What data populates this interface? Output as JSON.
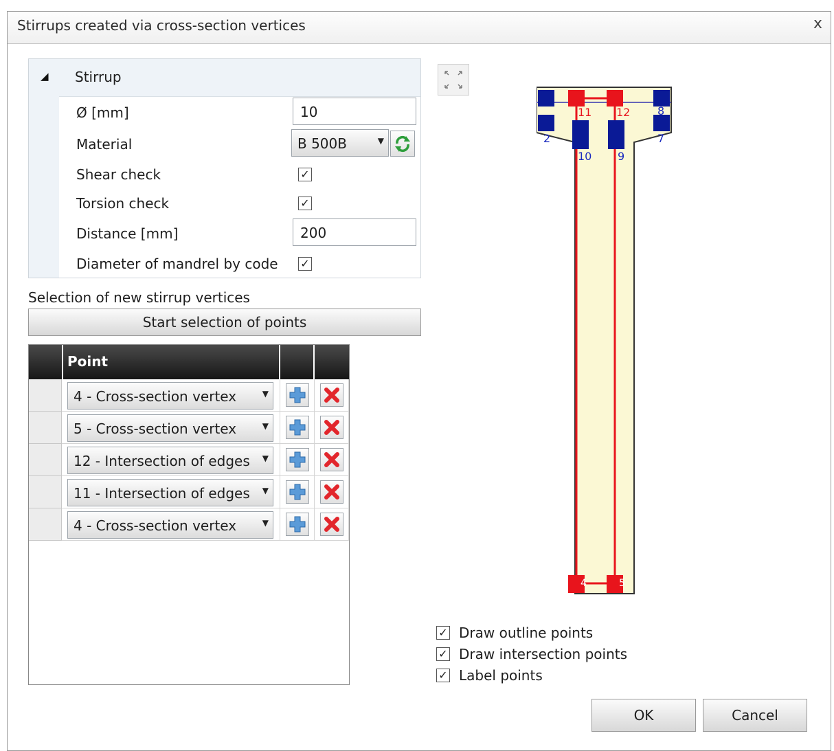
{
  "dialog": {
    "title": "Stirrups created via cross-section vertices",
    "close_label": "x"
  },
  "stirrup": {
    "header": "Stirrup",
    "diameter_label": "Ø [mm]",
    "diameter_value": "10",
    "material_label": "Material",
    "material_value": "B 500B",
    "shear_label": "Shear check",
    "shear_checked": true,
    "torsion_label": "Torsion check",
    "torsion_checked": true,
    "distance_label": "Distance [mm]",
    "distance_value": "200",
    "mandrel_label": "Diameter of mandrel by code",
    "mandrel_checked": true
  },
  "selection": {
    "label": "Selection of new stirrup vertices",
    "button_label": "Start selection of points"
  },
  "grid": {
    "header_point": "Point",
    "rows": [
      {
        "point": "4 - Cross-section vertex"
      },
      {
        "point": "5 - Cross-section vertex"
      },
      {
        "point": "12 - Intersection of edges"
      },
      {
        "point": "11 - Intersection of edges"
      },
      {
        "point": "4 - Cross-section vertex"
      }
    ]
  },
  "section_labels": [
    "2",
    "11",
    "12",
    "8",
    "10",
    "9",
    "7",
    "4",
    "5"
  ],
  "options": {
    "draw_outline_points": "Draw outline points",
    "draw_intersection_points": "Draw intersection points",
    "label_points": "Label points"
  },
  "buttons": {
    "ok": "OK",
    "cancel": "Cancel"
  },
  "colors": {
    "stirrup_red": "#e8141c",
    "vertex_blue": "#0a1a96",
    "section_fill": "#fbf8d4"
  }
}
